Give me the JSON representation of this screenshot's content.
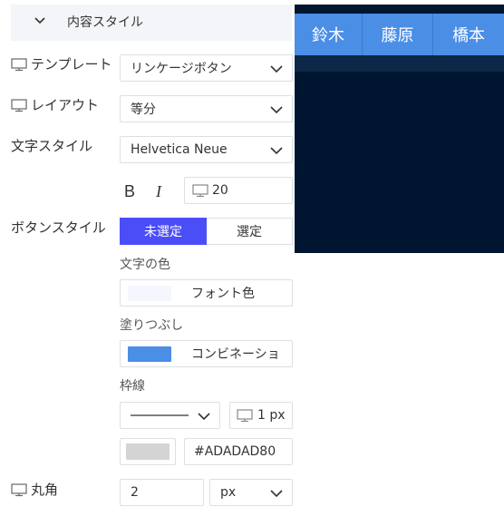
{
  "section": {
    "title": "内容スタイル"
  },
  "preview": {
    "tabs": [
      "鈴木",
      "藤原",
      "橋本"
    ],
    "colors": {
      "background": "#001530",
      "tab_bar": "#4a8ee6",
      "tab_text": "#ffffff"
    }
  },
  "template": {
    "label": "テンプレート",
    "value": "リンケージボタン"
  },
  "layout": {
    "label": "レイアウト",
    "value": "等分"
  },
  "text_style": {
    "label": "文字スタイル",
    "font": "Helvetica Neue",
    "bold_label": "B",
    "italic_label": "I",
    "size": "20"
  },
  "button_style": {
    "label": "ボタンスタイル",
    "options": [
      "未選定",
      "選定"
    ],
    "selected": "未選定",
    "accent": "#4b4ef7",
    "text_color": {
      "label": "文字の色",
      "name": "フォント色",
      "color": "#f4f7fd"
    },
    "fill": {
      "label": "塗りつぶし",
      "name": "コンビネーショ",
      "color": "#4a8ee6"
    },
    "border": {
      "label": "枠線",
      "width": "1 px",
      "color_value": "#ADADAD80",
      "swatch": "#d4d4d4"
    }
  },
  "radius": {
    "label": "丸角",
    "value": "2",
    "unit": "px"
  }
}
